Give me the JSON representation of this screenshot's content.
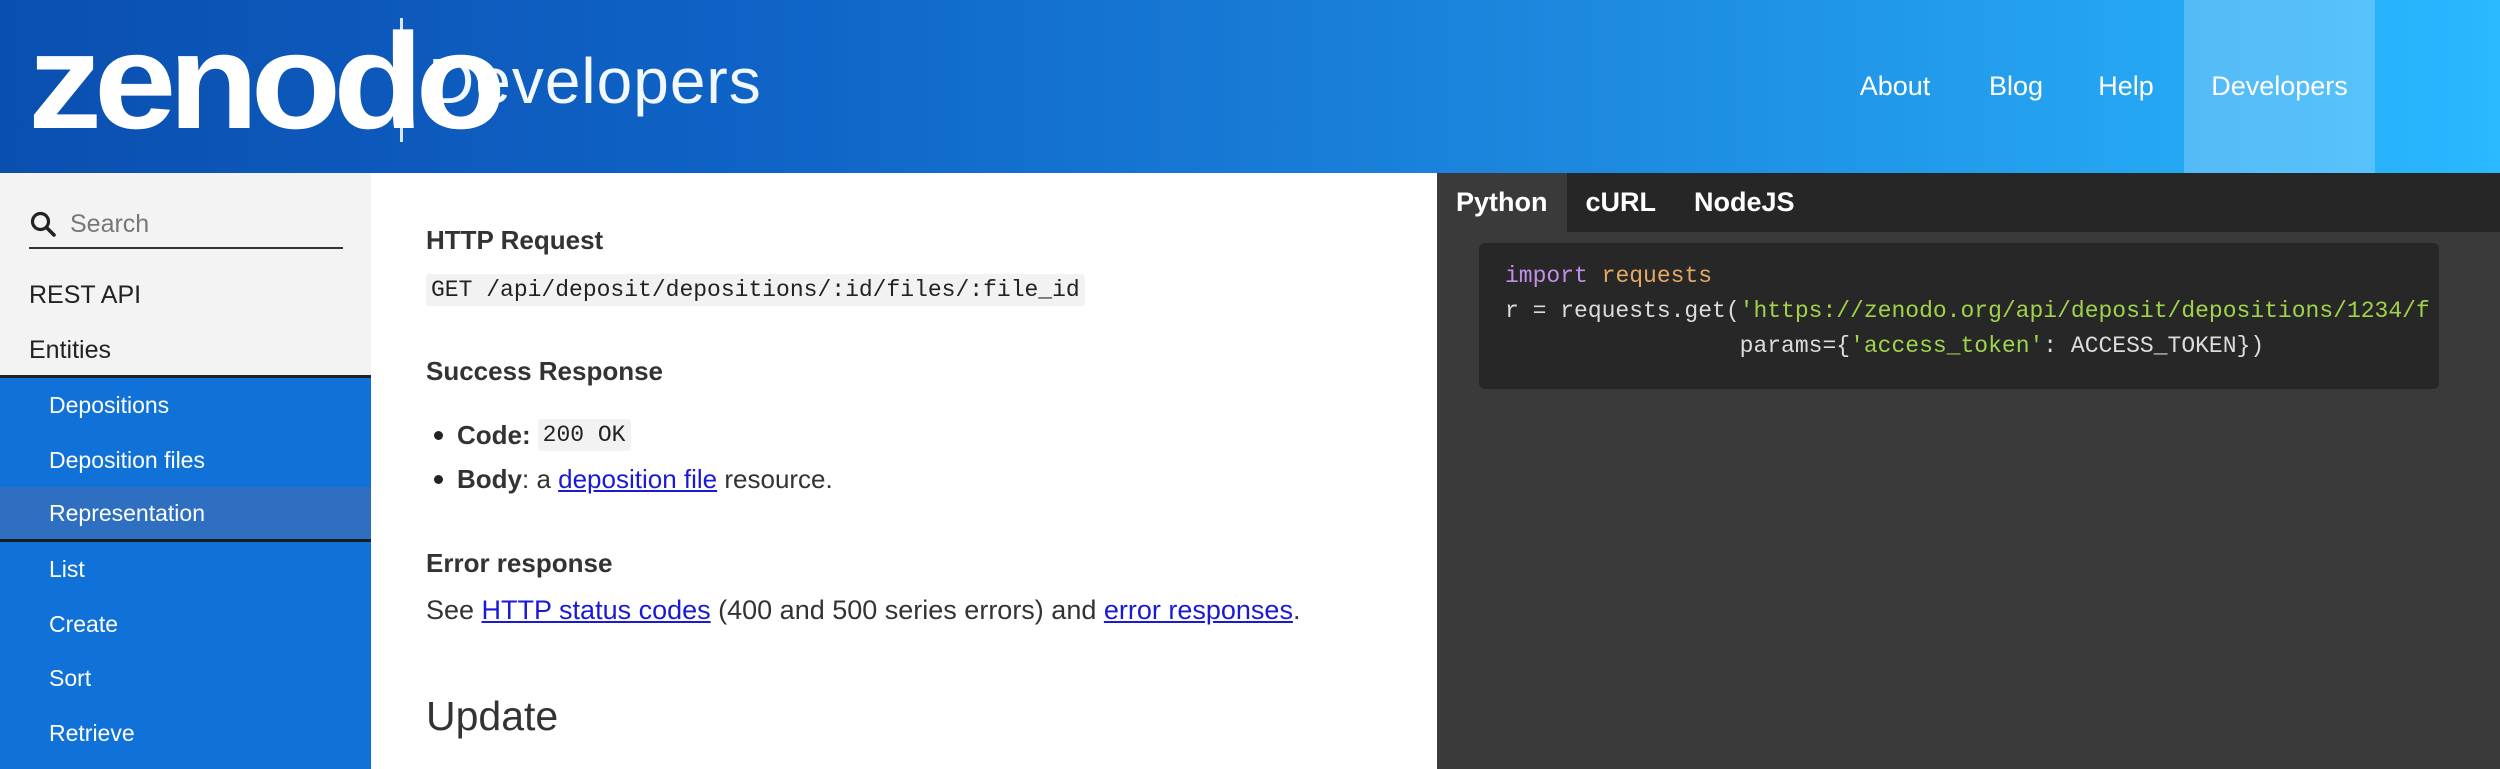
{
  "header": {
    "logo_text": "zenodo",
    "subtitle": "Developers",
    "nav": [
      {
        "label": "About"
      },
      {
        "label": "Blog"
      },
      {
        "label": "Help"
      },
      {
        "label": "Developers",
        "active": true
      }
    ],
    "gradient_colors": [
      "#0a4fb0",
      "#2ab8ff"
    ]
  },
  "sidebar": {
    "search_placeholder": "Search",
    "top_items": [
      "REST API",
      "Entities"
    ],
    "items": [
      {
        "label": "Depositions"
      },
      {
        "label": "Deposition files"
      },
      {
        "label": "Representation",
        "active": true
      },
      {
        "label": "List"
      },
      {
        "label": "Create"
      },
      {
        "label": "Sort"
      },
      {
        "label": "Retrieve"
      }
    ],
    "accent_color": "#1072d8"
  },
  "main": {
    "http_request_heading": "HTTP Request",
    "http_request_code": "GET /api/deposit/depositions/:id/files/:file_id",
    "success_heading": "Success Response",
    "success_code_label": "Code:",
    "success_code_value": "200 OK",
    "success_body_label": "Body",
    "success_body_prefix": ": a ",
    "success_body_link": "deposition file",
    "success_body_suffix": " resource.",
    "error_heading": "Error response",
    "error_prefix": "See ",
    "error_link1": "HTTP status codes",
    "error_middle": " (400 and 500 series errors) and ",
    "error_link2": "error responses",
    "error_suffix": ".",
    "next_section_title": "Update"
  },
  "code_pane": {
    "tabs": [
      {
        "label": "Python",
        "active": true
      },
      {
        "label": "cURL"
      },
      {
        "label": "NodeJS"
      }
    ],
    "code": {
      "line1_kw": "import",
      "line1_mod": "requests",
      "line2_prefix": "r = requests.get(",
      "line2_url": "'https://zenodo.org/api/deposit/depositions/1234/f",
      "line3_prefix": "                 params={",
      "line3_key": "'access_token'",
      "line3_suffix": ": ACCESS_TOKEN})"
    }
  }
}
